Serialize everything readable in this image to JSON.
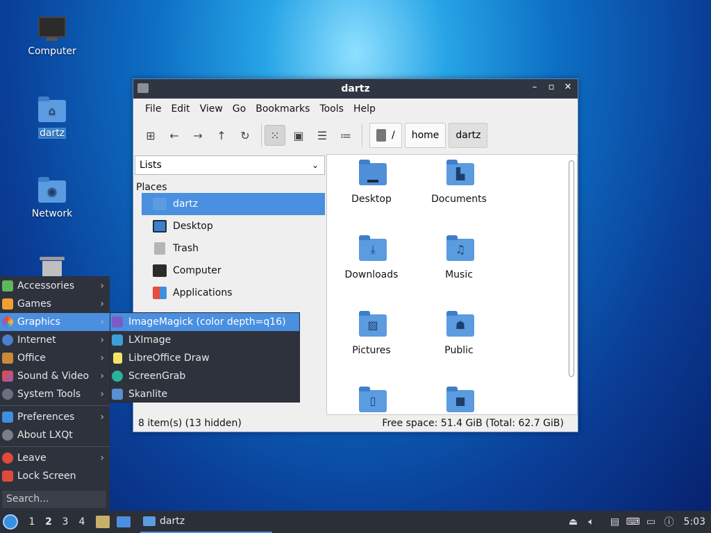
{
  "desktop": {
    "icons": [
      {
        "label": "Computer"
      },
      {
        "label": "dartz"
      },
      {
        "label": "Network"
      }
    ]
  },
  "window": {
    "title": "dartz",
    "controls": [
      "–",
      "▫",
      "✕"
    ],
    "menu": [
      "File",
      "Edit",
      "View",
      "Go",
      "Bookmarks",
      "Tools",
      "Help"
    ],
    "breadcrumb": [
      "/",
      "home",
      "dartz"
    ],
    "side_mode": "Lists",
    "places_header": "Places",
    "places": [
      "dartz",
      "Desktop",
      "Trash",
      "Computer",
      "Applications"
    ],
    "files": [
      "Desktop",
      "Documents",
      "Downloads",
      "Music",
      "Pictures",
      "Public",
      "",
      ""
    ],
    "status_left": "8 item(s) (13 hidden)",
    "status_right": "Free space: 51.4 GiB (Total: 62.7 GiB)"
  },
  "start_menu": {
    "items": [
      "Accessories",
      "Games",
      "Graphics",
      "Internet",
      "Office",
      "Sound & Video",
      "System Tools"
    ],
    "items2": [
      "Preferences",
      "About LXQt"
    ],
    "items3": [
      "Leave",
      "Lock Screen"
    ],
    "search_placeholder": "Search..."
  },
  "graphics_submenu": {
    "items": [
      "ImageMagick (color depth=q16)",
      "LXImage",
      "LibreOffice Draw",
      "ScreenGrab",
      "Skanlite"
    ]
  },
  "taskbar": {
    "workspaces": [
      "1",
      "2",
      "3",
      "4"
    ],
    "task_label": "dartz",
    "clock": "5:03"
  },
  "colors": {
    "accent": "#4a8fe0",
    "panel": "#2e323c",
    "titlebar": "#303641"
  }
}
